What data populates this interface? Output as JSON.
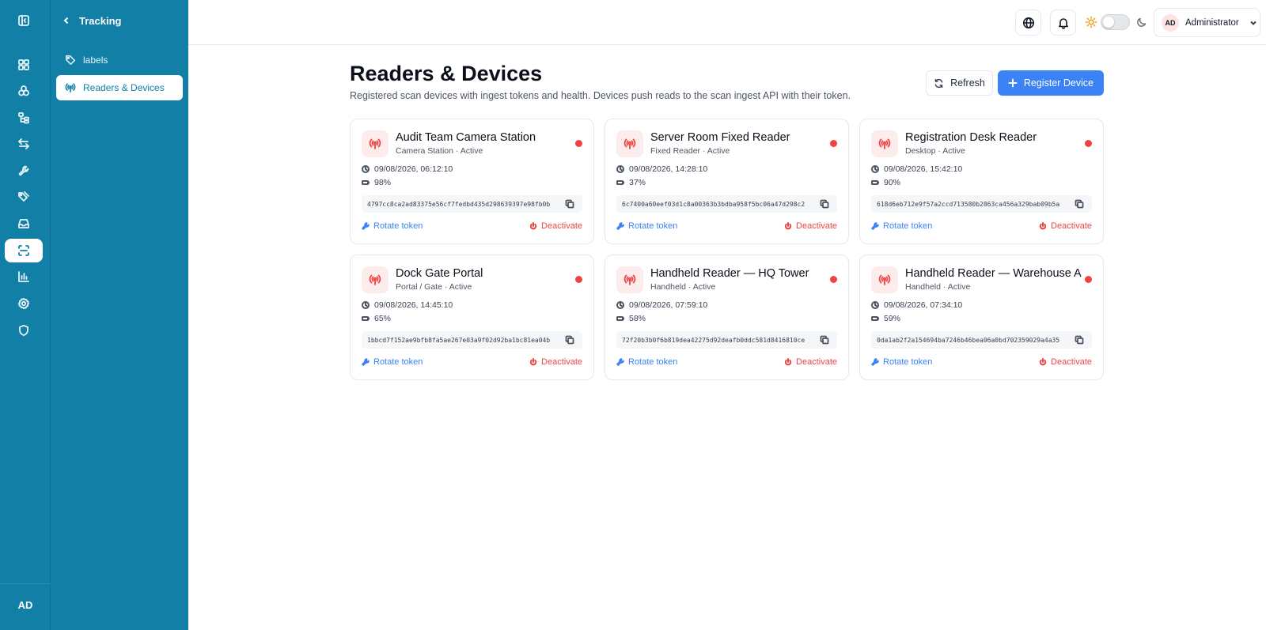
{
  "rail": {
    "avatar_initials": "AD",
    "items": [
      {
        "icon": "sidebar-toggle-icon"
      },
      {
        "icon": "dashboard-icon"
      },
      {
        "icon": "assets-icon"
      },
      {
        "icon": "hierarchy-icon"
      },
      {
        "icon": "transfer-icon"
      },
      {
        "icon": "wrench-icon"
      },
      {
        "icon": "tags-icon"
      },
      {
        "icon": "inbox-icon"
      },
      {
        "icon": "scan-icon",
        "active": true
      },
      {
        "icon": "reports-icon"
      },
      {
        "icon": "settings-icon"
      },
      {
        "icon": "shield-icon"
      }
    ]
  },
  "subnav": {
    "title": "Tracking",
    "items": [
      {
        "label": "labels",
        "icon": "tag-icon"
      },
      {
        "label": "Readers & Devices",
        "icon": "antenna-icon",
        "active": true
      }
    ]
  },
  "topbar": {
    "user_initials": "AD",
    "user_name": "Administrator"
  },
  "page": {
    "title": "Readers & Devices",
    "subtitle": "Registered scan devices with ingest tokens and health. Devices push reads to the scan ingest API with their token.",
    "refresh_label": "Refresh",
    "register_label": "Register Device"
  },
  "labels": {
    "rotate": "Rotate token",
    "deactivate": "Deactivate"
  },
  "colors": {
    "brand": "#117fa6",
    "primary": "#3b82f6",
    "danger": "#ef4444"
  },
  "devices": [
    {
      "name": "Audit Team Camera Station",
      "meta": "Camera Station · Active",
      "last_seen": "09/08/2026, 06:12:10",
      "battery": "98%",
      "token": "4797cc8ca2ad83375e56cf7fedbd435d298639397e98fb0b"
    },
    {
      "name": "Server Room Fixed Reader",
      "meta": "Fixed Reader · Active",
      "last_seen": "09/08/2026, 14:28:10",
      "battery": "37%",
      "token": "6c7400a60eef03d1c8a00363b3bdba958f5bc06a47d298c2"
    },
    {
      "name": "Registration Desk Reader",
      "meta": "Desktop · Active",
      "last_seen": "09/08/2026, 15:42:10",
      "battery": "90%",
      "token": "618d6eb712e9f57a2ccd713580b2863ca456a329bab09b5a"
    },
    {
      "name": "Dock Gate Portal",
      "meta": "Portal / Gate · Active",
      "last_seen": "09/08/2026, 14:45:10",
      "battery": "65%",
      "token": "1bbcd7f152ae9bfb8fa5ae267e03a9f02d92ba1bc81ea04b"
    },
    {
      "name": "Handheld Reader — HQ Tower",
      "meta": "Handheld · Active",
      "last_seen": "09/08/2026, 07:59:10",
      "battery": "58%",
      "token": "72f20b3b0f6b819dea42275d92deafb0ddc581d8416810ce"
    },
    {
      "name": "Handheld Reader — Warehouse A",
      "meta": "Handheld · Active",
      "last_seen": "09/08/2026, 07:34:10",
      "battery": "59%",
      "token": "0da1ab2f2a154694ba7246b46bea06a0bd702359029a4a35"
    }
  ]
}
